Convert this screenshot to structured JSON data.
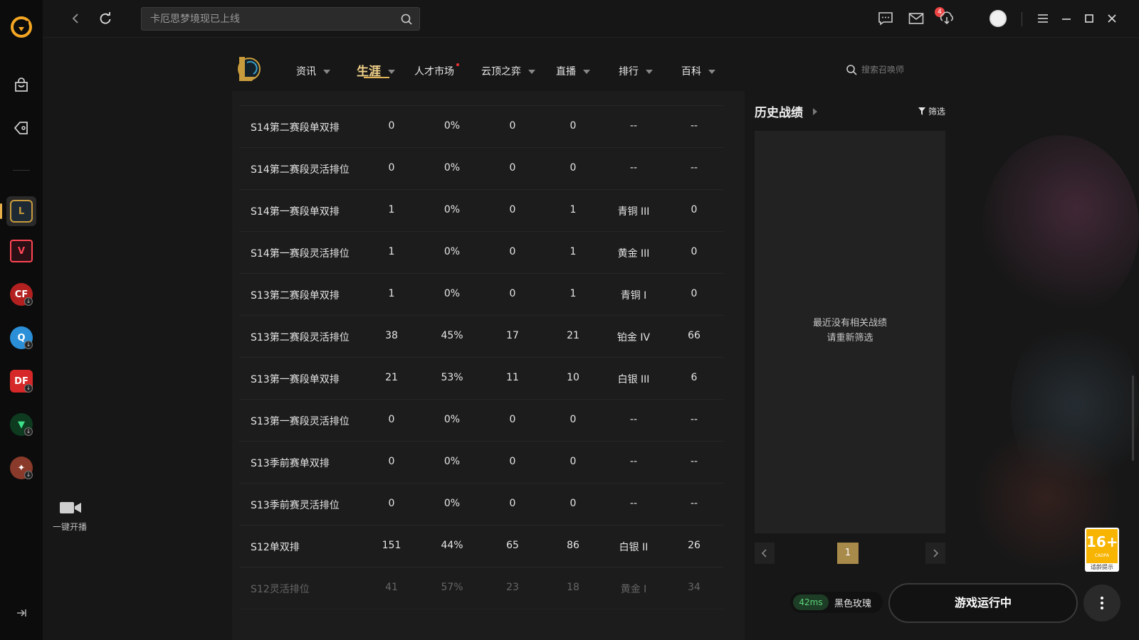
{
  "topbar": {
    "search_placeholder": "卡厄思梦境现已上线",
    "mail_badge": "4"
  },
  "sidebar": {
    "live_label": "一键开播"
  },
  "nav": {
    "items": [
      {
        "label": "资讯",
        "dropdown": true
      },
      {
        "label": "生涯",
        "dropdown": true,
        "active": true
      },
      {
        "label": "人才市场",
        "dropdown": false,
        "dot": true
      },
      {
        "label": "云顶之弈",
        "dropdown": true
      },
      {
        "label": "直播",
        "dropdown": true
      },
      {
        "label": "排行",
        "dropdown": true
      },
      {
        "label": "百科",
        "dropdown": true
      }
    ],
    "summoner_search_placeholder": "搜索召唤师"
  },
  "ranked_table": {
    "rows": [
      {
        "season": "S14第二赛段单双排",
        "games": "0",
        "winrate": "0%",
        "wins": "0",
        "losses": "0",
        "rank": "--",
        "points": "--"
      },
      {
        "season": "S14第二赛段灵活排位",
        "games": "0",
        "winrate": "0%",
        "wins": "0",
        "losses": "0",
        "rank": "--",
        "points": "--"
      },
      {
        "season": "S14第一赛段单双排",
        "games": "1",
        "winrate": "0%",
        "wins": "0",
        "losses": "1",
        "rank": "青铜 III",
        "points": "0"
      },
      {
        "season": "S14第一赛段灵活排位",
        "games": "1",
        "winrate": "0%",
        "wins": "0",
        "losses": "1",
        "rank": "黄金 III",
        "points": "0"
      },
      {
        "season": "S13第二赛段单双排",
        "games": "1",
        "winrate": "0%",
        "wins": "0",
        "losses": "1",
        "rank": "青铜 I",
        "points": "0"
      },
      {
        "season": "S13第二赛段灵活排位",
        "games": "38",
        "winrate": "45%",
        "wins": "17",
        "losses": "21",
        "rank": "铂金 IV",
        "points": "66"
      },
      {
        "season": "S13第一赛段单双排",
        "games": "21",
        "winrate": "53%",
        "wins": "11",
        "losses": "10",
        "rank": "白银 III",
        "points": "6"
      },
      {
        "season": "S13第一赛段灵活排位",
        "games": "0",
        "winrate": "0%",
        "wins": "0",
        "losses": "0",
        "rank": "--",
        "points": "--"
      },
      {
        "season": "S13季前赛单双排",
        "games": "0",
        "winrate": "0%",
        "wins": "0",
        "losses": "0",
        "rank": "--",
        "points": "--"
      },
      {
        "season": "S13季前赛灵活排位",
        "games": "0",
        "winrate": "0%",
        "wins": "0",
        "losses": "0",
        "rank": "--",
        "points": "--"
      },
      {
        "season": "S12单双排",
        "games": "151",
        "winrate": "44%",
        "wins": "65",
        "losses": "86",
        "rank": "白银 II",
        "points": "26"
      },
      {
        "season": "S12灵活排位",
        "games": "41",
        "winrate": "57%",
        "wins": "23",
        "losses": "18",
        "rank": "黄金 I",
        "points": "34"
      }
    ]
  },
  "history": {
    "title": "历史战绩",
    "filter_label": "筛选",
    "empty_line1": "最近没有相关战绩",
    "empty_line2": "请重新筛选",
    "page": "1"
  },
  "age_rating": {
    "value": "16+",
    "sub": "CADPA",
    "tip": "适龄提示"
  },
  "status": {
    "ping": "42ms",
    "server": "黑色玫瑰",
    "run_label": "游戏运行中"
  },
  "colors": {
    "accent_gold": "#e0b456",
    "ping_green": "#5cd47a"
  }
}
